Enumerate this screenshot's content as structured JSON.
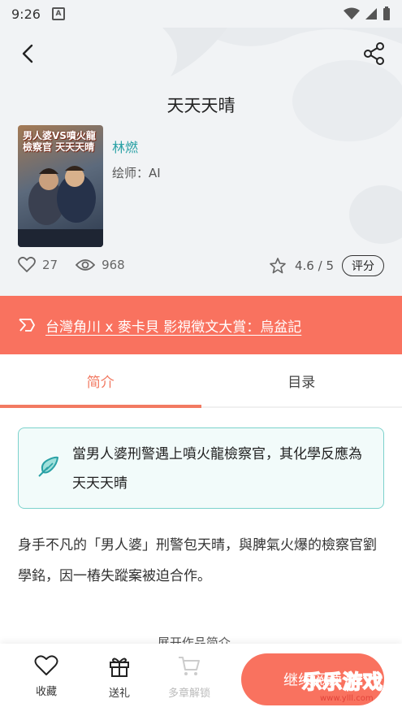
{
  "status_bar": {
    "time": "9:26",
    "notification_badge": "A"
  },
  "book": {
    "title": "天天天晴",
    "cover_text": "男人婆VS噴火龍檢察官 天天天晴",
    "author": "林燃",
    "illustrator": "绘师：AI",
    "likes": "27",
    "views": "968",
    "rating": "4.6 / 5",
    "rate_label": "评分"
  },
  "banner": {
    "text": "台灣角川 x 麥卡貝 影視徵文大賞：烏盆記"
  },
  "tabs": [
    {
      "label": "简介",
      "active": true
    },
    {
      "label": "目录",
      "active": false
    }
  ],
  "summary": {
    "text": "當男人婆刑警遇上噴火龍檢察官，其化學反應為天天天晴"
  },
  "description": "身手不凡的「男人婆」刑警包天晴，與脾氣火爆的檢察官劉學銘，因一樁失蹤案被迫合作。",
  "expand_label": "展开作品简介 ⌄",
  "bottom_bar": {
    "favorite_label": "收藏",
    "gift_label": "送礼",
    "unlock_label": "多章解锁",
    "continue_label": "继续阅读"
  },
  "watermark": {
    "text": "乐乐游戏",
    "url": "www.ylll.com"
  },
  "colors": {
    "accent": "#f9725f",
    "teal": "#2aa1a5",
    "tab_active": "#f27a62"
  }
}
